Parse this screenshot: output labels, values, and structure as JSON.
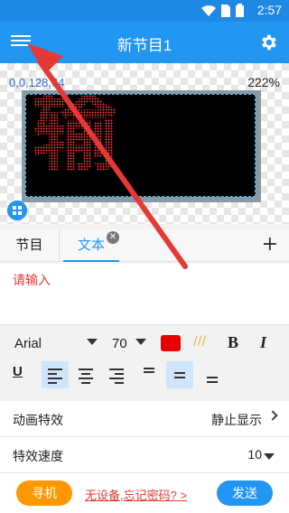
{
  "status_bar": {
    "time": "2:57",
    "icons": [
      "wifi-icon",
      "sim-icon",
      "battery-icon"
    ]
  },
  "app_bar": {
    "title": "新节目1",
    "menu_icon": "menu-icon",
    "settings_icon": "gear-icon"
  },
  "preview": {
    "coordinates": "0,0,128,64",
    "zoom": "222%",
    "led_text": "输",
    "led_color": "#e53935",
    "layout_icon": "grid-icon"
  },
  "tabs": {
    "items": [
      {
        "label": "节目"
      },
      {
        "label": "文本"
      }
    ],
    "active": "文本",
    "close_icon": "close-icon",
    "add_label": "+"
  },
  "text_input": {
    "placeholder": "请输入"
  },
  "font_toolbar": {
    "font_family": "Arial",
    "font_size": "70",
    "color": "#e60000",
    "bold_label": "B",
    "italic_label": "I",
    "gradient_label": "///"
  },
  "align_toolbar": {
    "underline_label": "U",
    "active_horizontal": "left",
    "active_vertical": "middle"
  },
  "menu": {
    "animation": {
      "label": "动画特效",
      "value": "静止显示"
    },
    "speed": {
      "label": "特效速度",
      "value": "10"
    }
  },
  "bottom_bar": {
    "nav_label": "寻机",
    "forgot_label": "无设备,忘记密码? >",
    "send_label": "发送"
  }
}
